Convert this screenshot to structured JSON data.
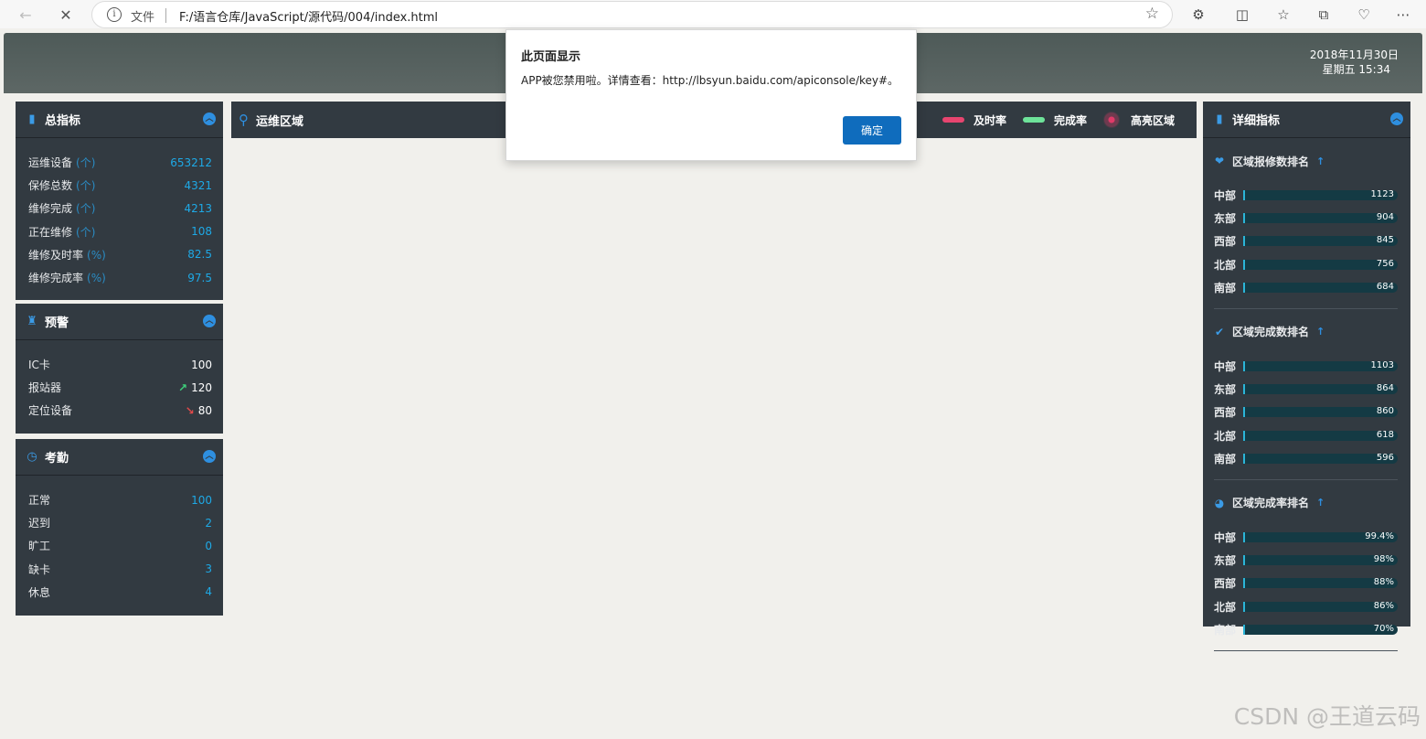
{
  "browser": {
    "file_label": "文件",
    "url": "F:/语言仓库/JavaScript/源代码/004/index.html"
  },
  "header": {
    "date": "2018年11月30日",
    "weekday_time": "星期五 15:34"
  },
  "total_panel": {
    "title": "总指标",
    "rows": [
      {
        "label": "运维设备",
        "unit": "(个)",
        "value": "653212"
      },
      {
        "label": "保修总数",
        "unit": "(个)",
        "value": "4321"
      },
      {
        "label": "维修完成",
        "unit": "(个)",
        "value": "4213"
      },
      {
        "label": "正在维修",
        "unit": "(个)",
        "value": "108"
      },
      {
        "label": "维修及时率",
        "unit": "(%)",
        "value": "82.5"
      },
      {
        "label": "维修完成率",
        "unit": "(%)",
        "value": "97.5"
      }
    ]
  },
  "warning_panel": {
    "title": "预警",
    "rows": [
      {
        "label": "IC卡",
        "value": "100",
        "trend": ""
      },
      {
        "label": "报站器",
        "value": "120",
        "trend": "up"
      },
      {
        "label": "定位设备",
        "value": "80",
        "trend": "down"
      }
    ]
  },
  "attendance_panel": {
    "title": "考勤",
    "rows": [
      {
        "label": "正常",
        "value": "100"
      },
      {
        "label": "迟到",
        "value": "2"
      },
      {
        "label": "旷工",
        "value": "0"
      },
      {
        "label": "缺卡",
        "value": "3"
      },
      {
        "label": "休息",
        "value": "4"
      }
    ]
  },
  "center": {
    "title": "运维区域",
    "legend": [
      {
        "label": "及时率",
        "color": "#e8456f"
      },
      {
        "label": "完成率",
        "color": "#6ee39a"
      },
      {
        "label": "高亮区域",
        "color": "#e03a68"
      }
    ]
  },
  "detail_panel": {
    "title": "详细指标",
    "sections": [
      {
        "title": "区域报修数排名",
        "arrow": "↑",
        "items": [
          {
            "region": "中部",
            "value": "1123"
          },
          {
            "region": "东部",
            "value": "904"
          },
          {
            "region": "西部",
            "value": "845"
          },
          {
            "region": "北部",
            "value": "756"
          },
          {
            "region": "南部",
            "value": "684"
          }
        ]
      },
      {
        "title": "区域完成数排名",
        "arrow": "↑",
        "items": [
          {
            "region": "中部",
            "value": "1103"
          },
          {
            "region": "东部",
            "value": "864"
          },
          {
            "region": "西部",
            "value": "860"
          },
          {
            "region": "北部",
            "value": "618"
          },
          {
            "region": "南部",
            "value": "596"
          }
        ]
      },
      {
        "title": "区域完成率排名",
        "arrow": "↑",
        "items": [
          {
            "region": "中部",
            "value": "99.4%"
          },
          {
            "region": "东部",
            "value": "98%"
          },
          {
            "region": "西部",
            "value": "88%"
          },
          {
            "region": "北部",
            "value": "86%"
          },
          {
            "region": "南部",
            "value": "70%"
          }
        ]
      }
    ]
  },
  "dialog": {
    "title": "此页面显示",
    "message": "APP被您禁用啦。详情查看：http://lbsyun.baidu.com/apiconsole/key#。",
    "ok_label": "确定"
  },
  "watermark": "CSDN @王道云码"
}
